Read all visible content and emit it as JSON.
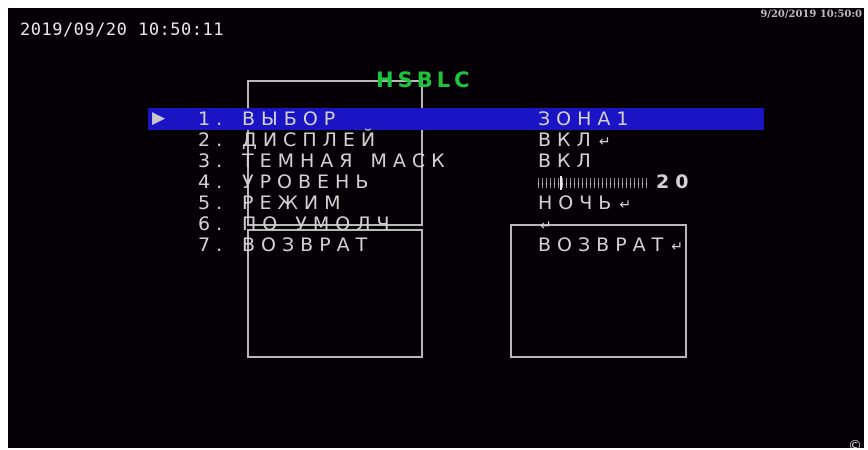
{
  "osd": {
    "timestamp": "2019/09/20 10:50:11",
    "timestamp_small": "9/20/2019 10:50:0"
  },
  "menu": {
    "title": "HSBLC",
    "cursor": "▶",
    "enter_icon": "enter-icon",
    "items": [
      {
        "number": "1.",
        "label": "ВЫБОР",
        "value": "ЗОНА1",
        "selected": true
      },
      {
        "number": "2.",
        "label": "ДИСПЛЕЙ",
        "value": "ВКЛ",
        "has_enter": true
      },
      {
        "number": "3.",
        "label": "ТЕМНАЯ МАСК",
        "value": "ВКЛ"
      },
      {
        "number": "4.",
        "label": "УРОВЕНЬ",
        "value": "20",
        "slider_fraction": 0.2
      },
      {
        "number": "5.",
        "label": "РЕЖИМ",
        "value": "НОЧЬ",
        "has_enter": true
      },
      {
        "number": "6.",
        "label": "ПО УМОЛЧ",
        "value": "",
        "has_enter": true
      },
      {
        "number": "7.",
        "label": "ВОЗВРАТ",
        "value": "ВОЗВРАТ",
        "has_enter": true
      }
    ]
  },
  "enter_glyph": "↵",
  "corner_glyph": "© ",
  "colors": {
    "background": "#050005",
    "title": "#1fc23b",
    "selection": "#1a14c4",
    "text": "#d2d2d2"
  }
}
